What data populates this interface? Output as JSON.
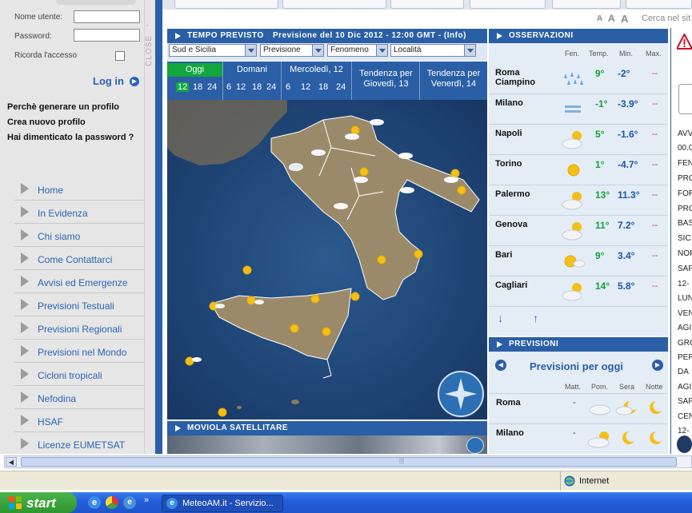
{
  "login": {
    "username_label": "Nome utente:",
    "password_label": "Password:",
    "remember_label": "Ricorda l'accesso",
    "login_link": "Log in",
    "close_label": "CLOSE"
  },
  "profile_links": [
    "Perchè generare un profilo",
    "Crea nuovo profilo",
    "Hai dimenticato la password ?"
  ],
  "nav": [
    "Home",
    "In Evidenza",
    "Chi siamo",
    "Come Contattarci",
    "Avvisi ed Emergenze",
    "Previsioni Testuali",
    "Previsioni Regionali",
    "Previsioni nel Mondo",
    "Cicloni tropicali",
    "Nefodina",
    "HSAF",
    "Licenze EUMETSAT"
  ],
  "header": {
    "font_sizes": [
      "A",
      "A",
      "A"
    ],
    "search_text": "Cerca nel sit"
  },
  "forecast": {
    "title": "TEMPO PREVISTO",
    "subtitle": "Previsione del 10 Dic 2012 - 12:00 GMT - (Info)",
    "selects": [
      "Sud e Sicilia",
      "Previsione",
      "Fenomeno",
      "Località"
    ],
    "days": [
      {
        "name": "Oggi",
        "hours": [
          "12",
          "18",
          "24"
        ]
      },
      {
        "name": "Domani",
        "hours": [
          "6",
          "12",
          "18",
          "24"
        ]
      },
      {
        "name": "Mercoledì, 12",
        "hours": [
          "6",
          "12",
          "18",
          "24"
        ]
      }
    ],
    "trends": [
      {
        "line1": "Tendenza per",
        "line2": "Giovedì, 13"
      },
      {
        "line1": "Tendenza per",
        "line2": "Venerdì, 14"
      }
    ]
  },
  "satellite": {
    "title": "MOVIOLA SATELLITARE"
  },
  "observations": {
    "title": "OSSERVAZIONI",
    "columns": [
      "Fen.",
      "Temp.",
      "Min.",
      "Max."
    ],
    "rows": [
      {
        "city": "Roma Ciampino",
        "icon": "rain-icon",
        "temp": "9°",
        "min": "-2°",
        "max": "--"
      },
      {
        "city": "Milano",
        "icon": "fog-icon",
        "temp": "-1°",
        "min": "-3.9°",
        "max": "--"
      },
      {
        "city": "Napoli",
        "icon": "partly-cloudy-icon",
        "temp": "5°",
        "min": "-1.6°",
        "max": "--"
      },
      {
        "city": "Torino",
        "icon": "sun-icon",
        "temp": "1°",
        "min": "-4.7°",
        "max": "--"
      },
      {
        "city": "Palermo",
        "icon": "partly-cloudy-icon",
        "temp": "13°",
        "min": "11.3°",
        "max": "--"
      },
      {
        "city": "Genova",
        "icon": "partly-cloudy-icon",
        "temp": "11°",
        "min": "7.2°",
        "max": "--"
      },
      {
        "city": "Bari",
        "icon": "sun-cloud-icon",
        "temp": "9°",
        "min": "3.4°",
        "max": "--"
      },
      {
        "city": "Cagliari",
        "icon": "partly-cloudy-icon",
        "temp": "14°",
        "min": "5.8°",
        "max": "--"
      }
    ]
  },
  "previsioni": {
    "title": "PREVISIONI",
    "heading": "Previsioni per oggi",
    "columns": [
      "Matt.",
      "Pom.",
      "Sera",
      "Notte"
    ],
    "rows": [
      {
        "city": "Roma",
        "matt": "-"
      },
      {
        "city": "Milano",
        "matt": "-"
      }
    ]
  },
  "right_column": [
    "AVV",
    "00.0",
    "FEN",
    "PRO",
    "FOR",
    "PRO",
    "BAS",
    "SIC",
    "NOF",
    "SAF",
    "12-",
    "LUN",
    "VEN",
    "AGI",
    "GRO",
    "PER",
    "DA",
    "AGI",
    "SAF",
    "CEN",
    "12-"
  ],
  "browser": {
    "status_zone": "Internet"
  },
  "taskbar": {
    "start": "start",
    "task_title": "MeteoAM.it - Servizio..."
  },
  "colors": {
    "brand_blue": "#2a5fa6",
    "selected_green": "#12a63e",
    "temp_green": "#14a23c",
    "temp_blue": "#1d56a8"
  }
}
